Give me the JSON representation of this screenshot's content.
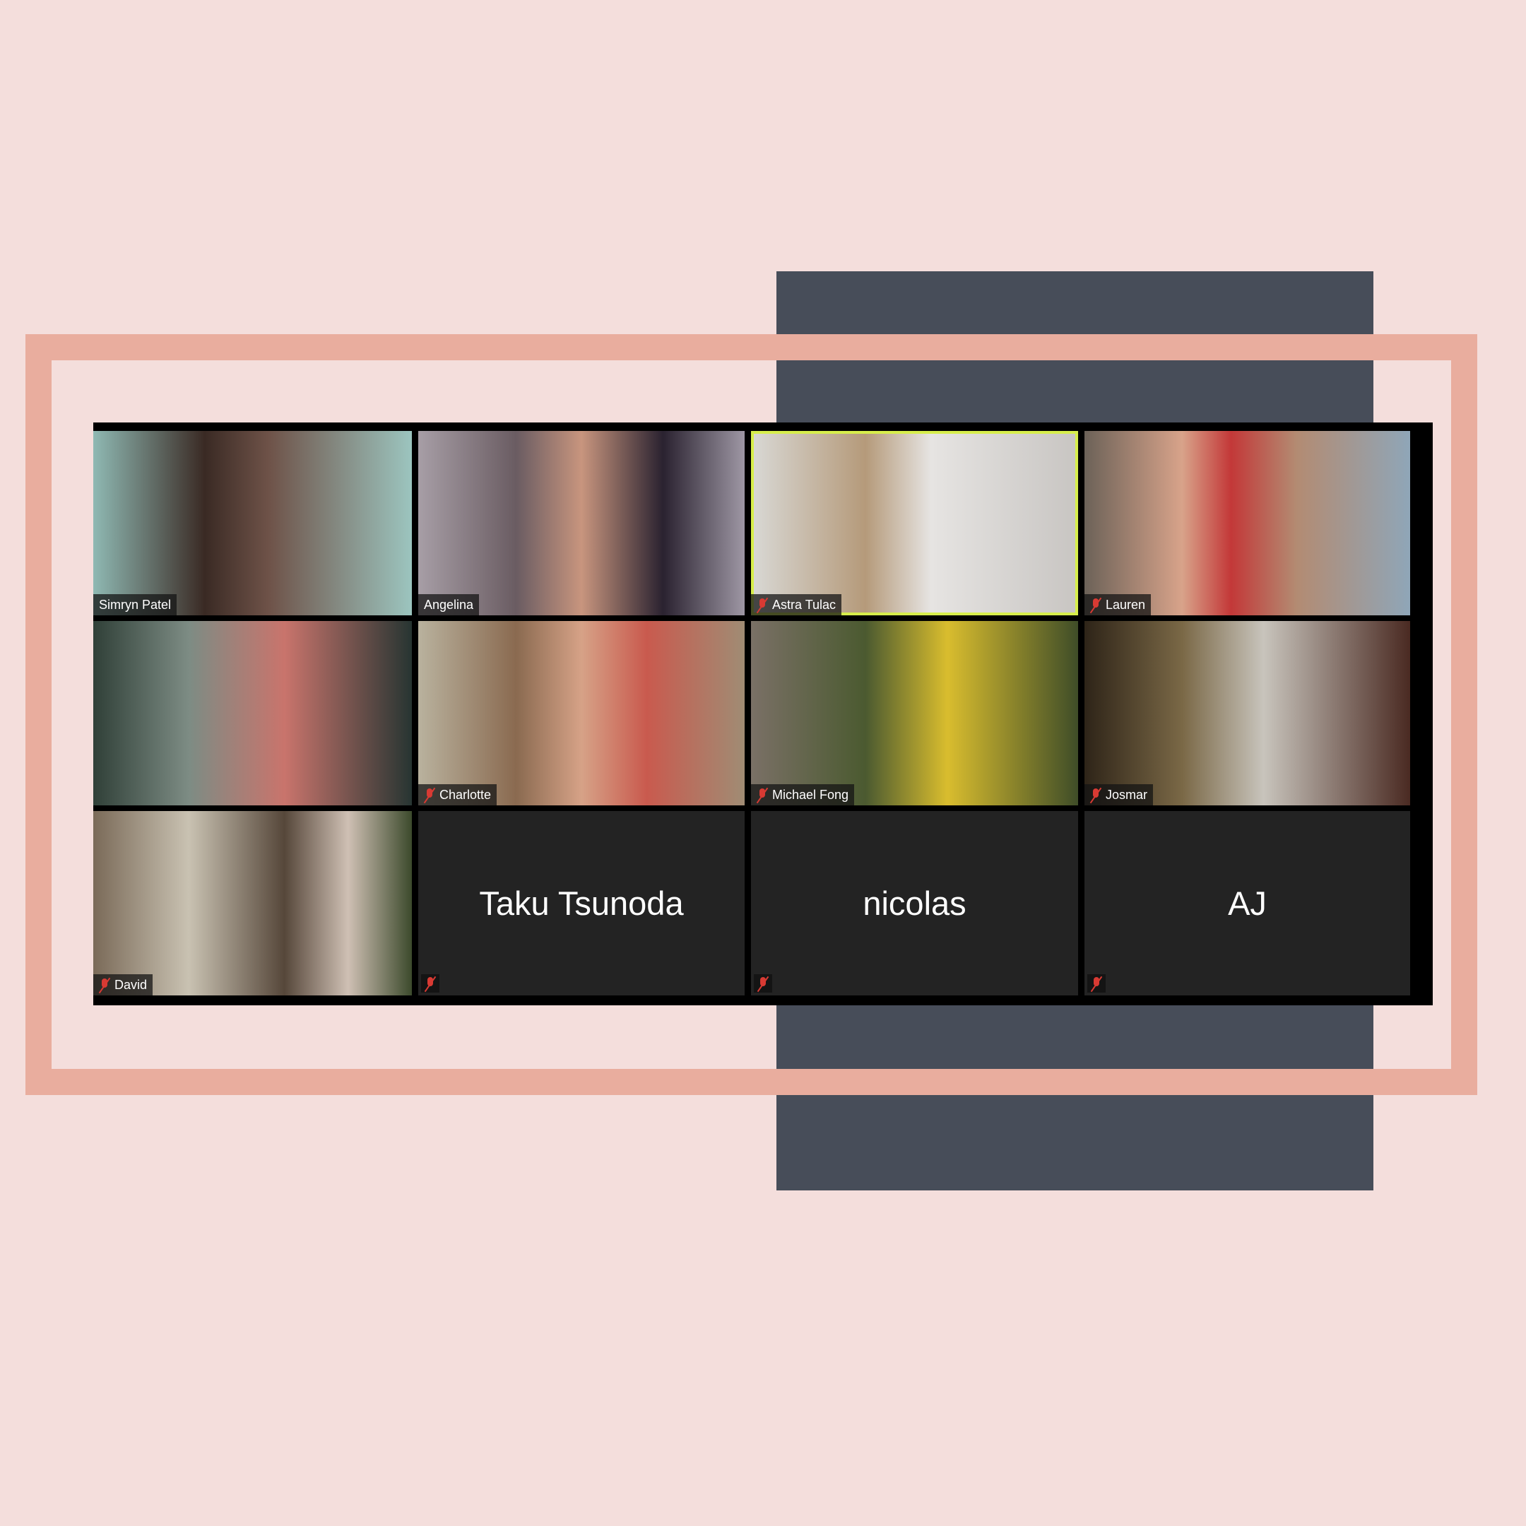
{
  "colors": {
    "background": "#f4dedc",
    "frame": "#e9ad9e",
    "dark_block": "#474d59",
    "active_speaker": "#d7ee4b",
    "muted": "#d83a33"
  },
  "participants": [
    {
      "name": "Simryn Patel",
      "muted": false,
      "video": true,
      "bg": "linear-gradient(90deg,#8fb9b3 0%,#3a2a24 35%,#6e5248 55%,#9cc5bf 100%)"
    },
    {
      "name": "Angelina",
      "muted": false,
      "video": true,
      "bg": "linear-gradient(90deg,#a79ea6 0%,#6a5c62 30%,#c8957e 50%,#2a2230 75%,#9e97a4 100%)"
    },
    {
      "name": "Astra Tulac",
      "muted": true,
      "video": true,
      "active": true,
      "bg": "linear-gradient(90deg,#d9d9d6 0%,#b59a7a 35%,#e6e4e2 55%,#c8c5c2 100%)"
    },
    {
      "name": "Lauren",
      "muted": true,
      "video": true,
      "bg": "linear-gradient(90deg,#6c6258 0%,#d8a38a 30%,#c33838 45%,#b38b72 65%,#8fa6b8 100%)"
    },
    {
      "name": "",
      "muted": false,
      "video": true,
      "bg": "linear-gradient(90deg,#304038 0%,#7d8c84 30%,#c9746c 60%,#273532 100%)"
    },
    {
      "name": "Charlotte",
      "muted": true,
      "video": true,
      "bg": "linear-gradient(90deg,#b9b29e 0%,#8a6a50 30%,#d6a287 50%,#c95a4e 70%,#a08c74 100%)"
    },
    {
      "name": "Michael Fong",
      "muted": true,
      "video": true,
      "bg": "linear-gradient(90deg,#7a7066 0%,#4b5a30 35%,#d9bd2e 60%,#3f4d28 100%)"
    },
    {
      "name": "Josmar",
      "muted": true,
      "video": true,
      "bg": "linear-gradient(90deg,#2e2418 0%,#7a6846 30%,#c8c4bc 55%,#4a2a22 100%)"
    },
    {
      "name": "David",
      "muted": true,
      "video": true,
      "bg": "linear-gradient(90deg,#7a6a58 0%,#c9c2b2 30%,#56473a 60%,#cfc0b4 80%,#3c4a2c 100%)"
    },
    {
      "name": "Taku Tsunoda",
      "muted": true,
      "video": false
    },
    {
      "name": "nicolas",
      "muted": true,
      "video": false
    },
    {
      "name": "AJ",
      "muted": true,
      "video": false
    }
  ]
}
